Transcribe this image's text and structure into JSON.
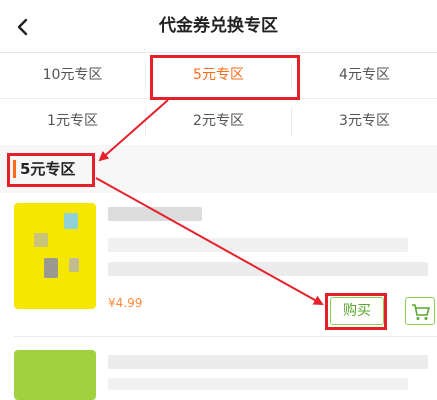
{
  "header": {
    "title": "代金券兑换专区",
    "back_icon": "chevron-left-icon"
  },
  "zones": [
    {
      "label": "10元专区",
      "active": false
    },
    {
      "label": "5元专区",
      "active": true
    },
    {
      "label": "4元专区",
      "active": false
    },
    {
      "label": "1元专区",
      "active": false
    },
    {
      "label": "2元专区",
      "active": false
    },
    {
      "label": "3元专区",
      "active": false
    }
  ],
  "section": {
    "title": "5元专区"
  },
  "products": [
    {
      "price": "¥4.99",
      "buy_label": "购买",
      "cart_icon": "cart-icon"
    }
  ],
  "colors": {
    "accent": "#ff6a1a",
    "buy_green": "#5aa72e",
    "annotation_red": "#e5202a"
  }
}
